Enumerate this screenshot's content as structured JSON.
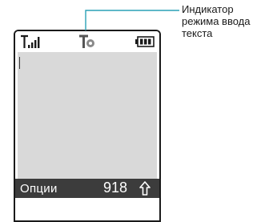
{
  "status_bar": {
    "signal_icon": "signal-strength-icon",
    "input_mode_icon": "text-input-mode-icon",
    "battery_icon": "battery-icon"
  },
  "softkey_bar": {
    "left_label": "Опции",
    "char_count": "918",
    "shift_icon": "shift-arrow-icon"
  },
  "callout": {
    "lines": [
      "Индикатор",
      "режима ввода",
      "текста"
    ]
  },
  "colors": {
    "text_area": "#d9d9d9",
    "softkey_bg": "#3c3c3c",
    "accent_line": "#2aa1b6"
  }
}
